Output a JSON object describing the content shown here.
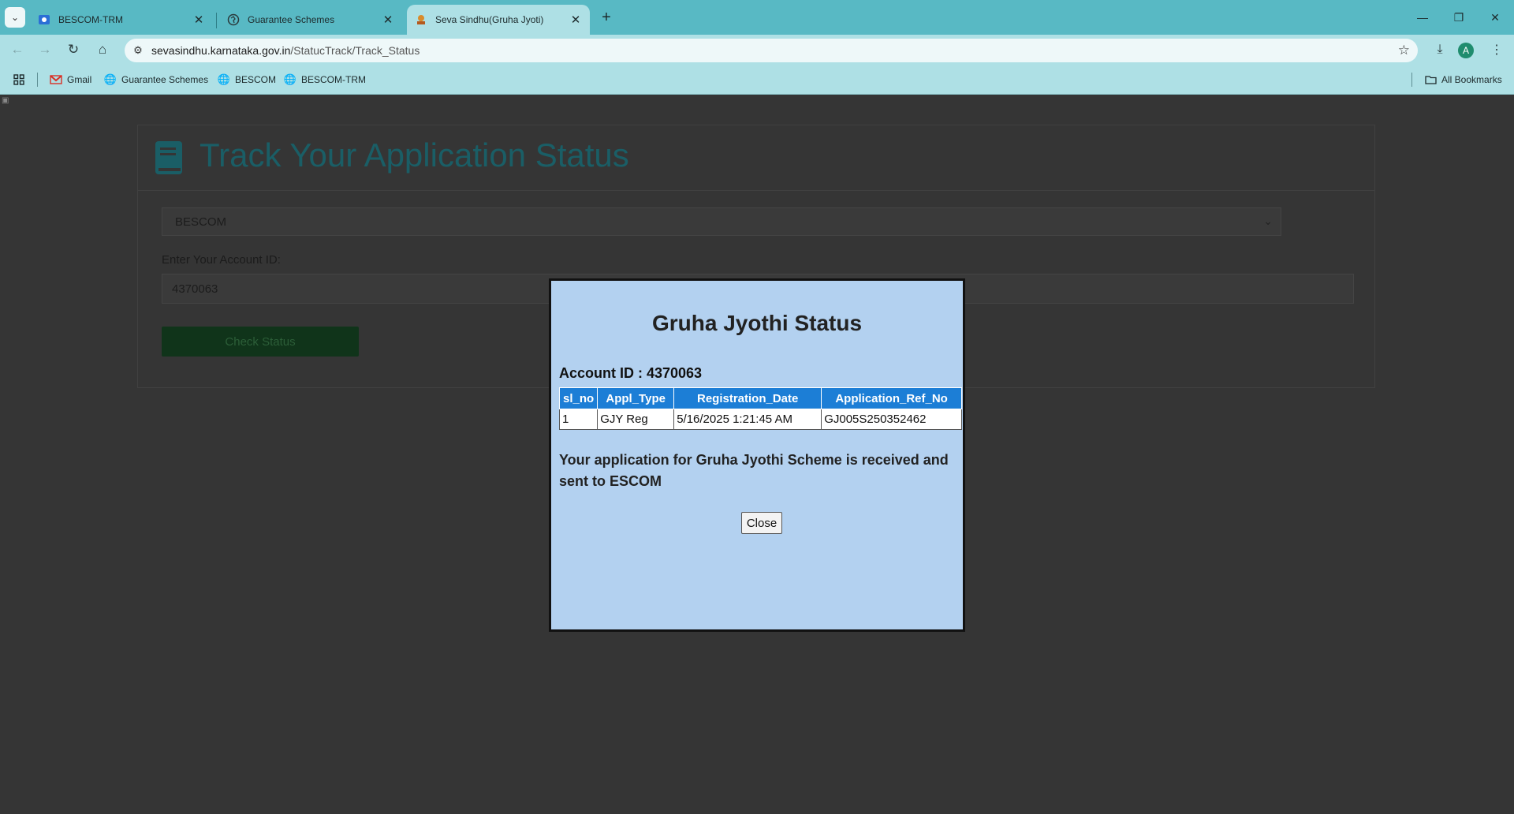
{
  "browser": {
    "tabs": [
      {
        "title": "BESCOM-TRM",
        "active": false
      },
      {
        "title": "Guarantee Schemes",
        "active": false
      },
      {
        "title": "Seva Sindhu(Gruha Jyoti)",
        "active": true
      }
    ],
    "url_host": "sevasindhu.karnataka.gov.in",
    "url_path": "/StatucTrack/Track_Status",
    "profile_initial": "A",
    "bookmarks": [
      {
        "label": "Gmail",
        "icon": "gmail-icon"
      },
      {
        "label": "Guarantee Schemes",
        "icon": "globe-icon"
      },
      {
        "label": "BESCOM",
        "icon": "globe-icon"
      },
      {
        "label": "BESCOM-TRM",
        "icon": "globe-icon"
      }
    ],
    "all_bookmarks_label": "All Bookmarks"
  },
  "page": {
    "title": "Track Your Application Status",
    "escom_select_value": "BESCOM",
    "account_label": "Enter Your Account ID:",
    "account_value": "4370063",
    "check_button_label": "Check Status"
  },
  "modal": {
    "title": "Gruha Jyothi Status",
    "account_line": "Account ID : 4370063",
    "table": {
      "headers": [
        "sl_no",
        "Appl_Type",
        "Registration_Date",
        "Application_Ref_No"
      ],
      "rows": [
        [
          "1",
          "GJY Reg",
          "5/16/2025 1:21:45 AM",
          "GJ005S250352462"
        ]
      ]
    },
    "message": "Your application for Gruha Jyothi Scheme is received and sent to ESCOM",
    "close_label": "Close"
  },
  "colors": {
    "tabstrip": "#58b9c4",
    "toolbar": "#aee0e5",
    "page_title": "#1a5e66",
    "modal_bg": "#b3d1f0",
    "table_header": "#1c7ed6"
  }
}
